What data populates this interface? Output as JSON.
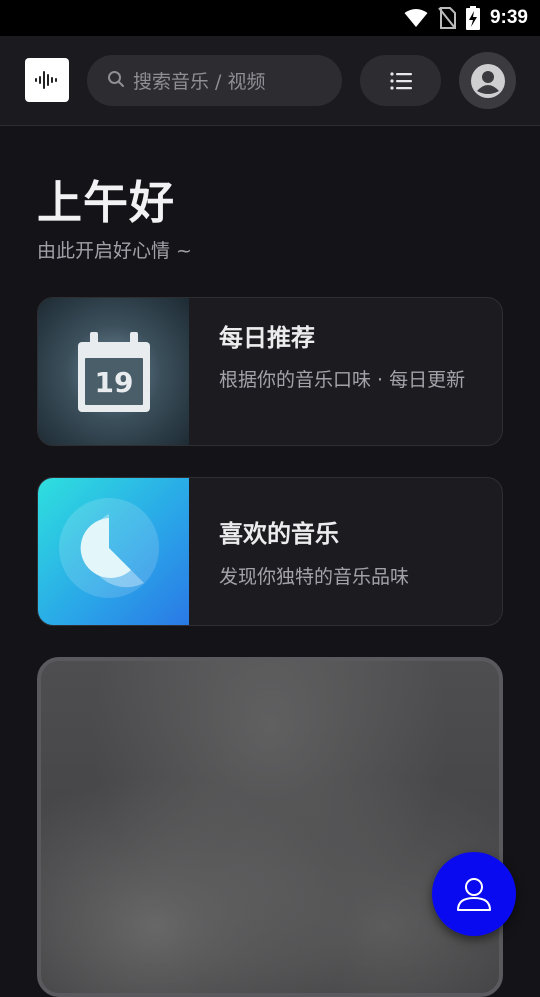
{
  "status_bar": {
    "time": "9:39"
  },
  "search": {
    "placeholder": "搜索音乐 / 视频"
  },
  "greeting": {
    "title": "上午好",
    "subtitle": "由此开启好心情 ~"
  },
  "cards": [
    {
      "title": "每日推荐",
      "description": "根据你的音乐口味 · 每日更新",
      "calendar_day": "19"
    },
    {
      "title": "喜欢的音乐",
      "description": "发现你独特的音乐品味"
    }
  ],
  "colors": {
    "accent": "#0a0af0",
    "background": "#141418",
    "card": "#1c1c20"
  }
}
